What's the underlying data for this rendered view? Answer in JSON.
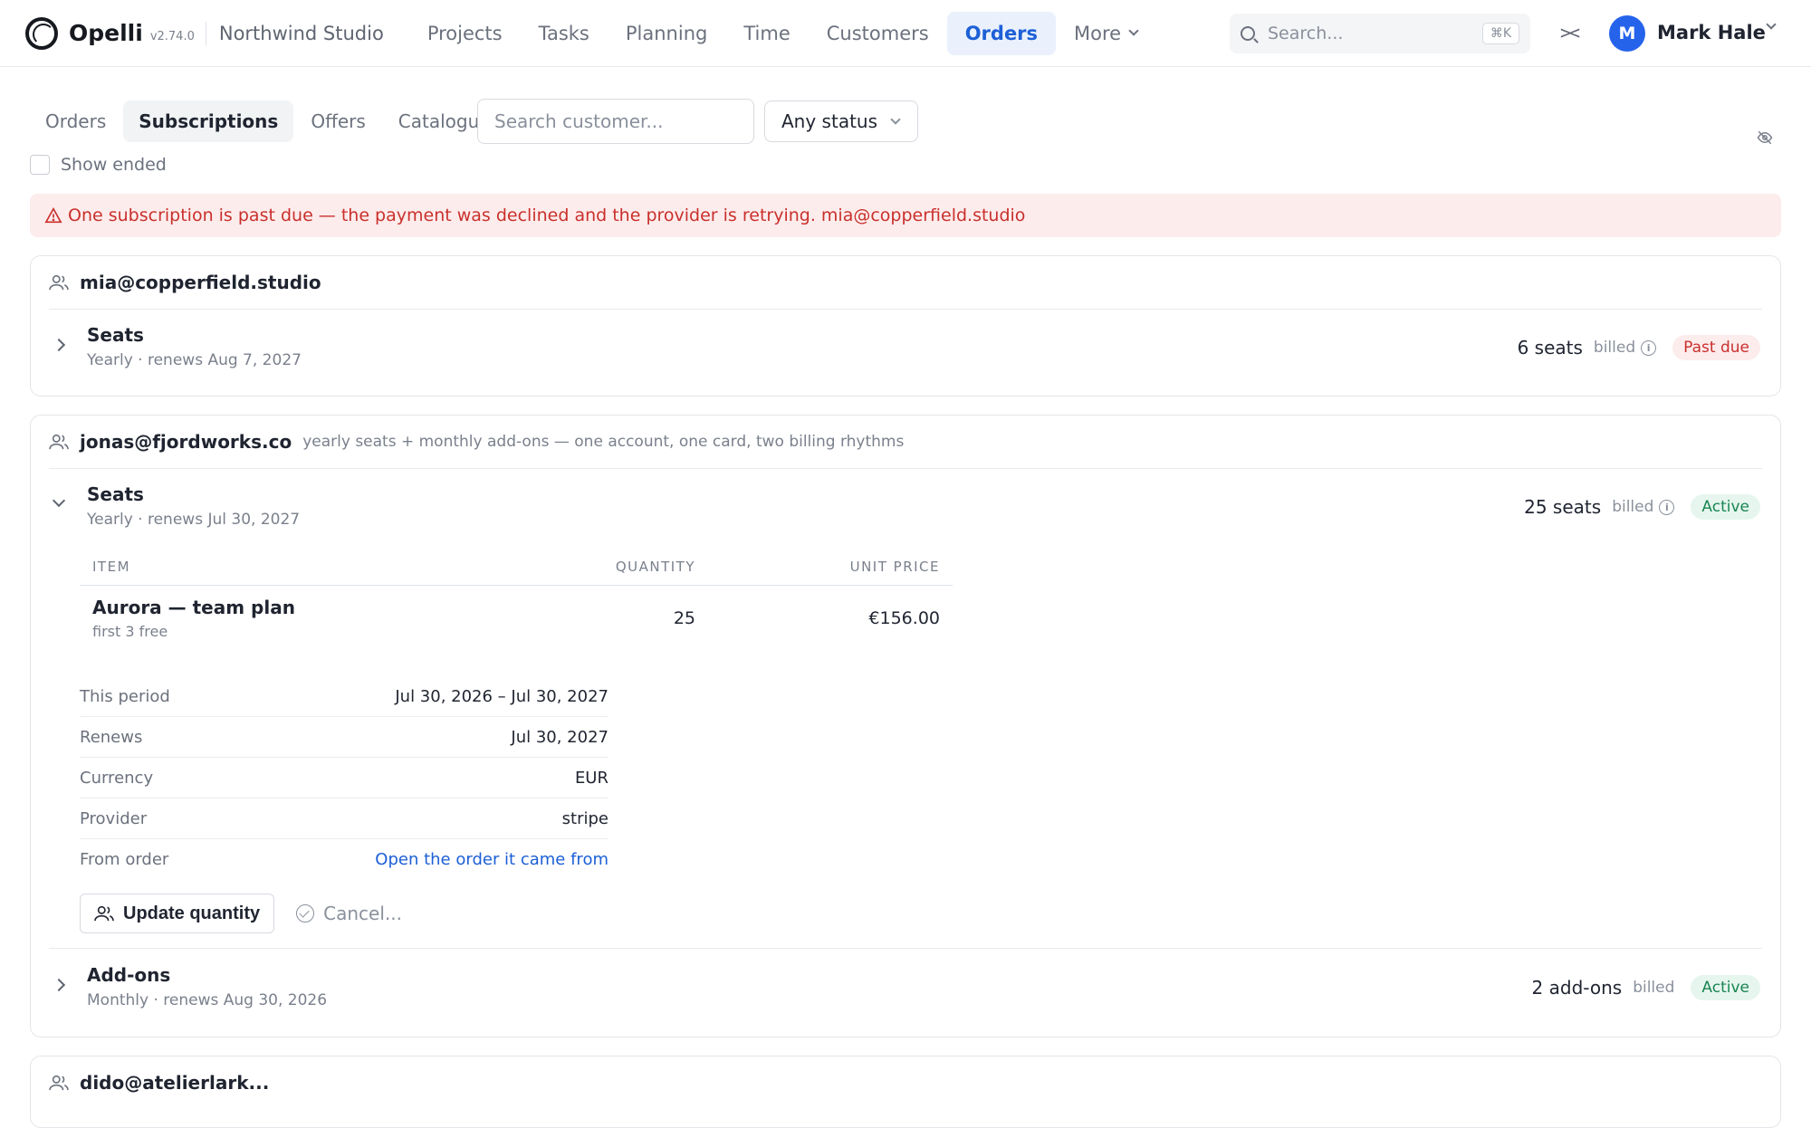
{
  "app": {
    "name": "Opelli",
    "version": "v2.74.0",
    "workspace": "Northwind Studio"
  },
  "nav": {
    "items": [
      {
        "label": "Projects"
      },
      {
        "label": "Tasks"
      },
      {
        "label": "Planning"
      },
      {
        "label": "Time"
      },
      {
        "label": "Customers"
      },
      {
        "label": "Orders"
      },
      {
        "label": "More"
      }
    ],
    "active": "Orders"
  },
  "search": {
    "placeholder": "Search...",
    "shortcut": "⌘K"
  },
  "user": {
    "initial": "M",
    "name": "Mark Hale"
  },
  "subtabs": {
    "items": [
      {
        "label": "Orders"
      },
      {
        "label": "Subscriptions"
      },
      {
        "label": "Offers"
      },
      {
        "label": "Catalogue"
      }
    ],
    "active": "Subscriptions"
  },
  "filters": {
    "customer_placeholder": "Search customer...",
    "status_value": "Any status",
    "show_ended_label": "Show ended"
  },
  "alert": {
    "text": "One subscription is past due — the payment was declined and the provider is retrying. mia@copperfield.studio"
  },
  "customers": [
    {
      "email": "mia@copperfield.studio",
      "subscriptions": [
        {
          "title": "Seats",
          "meta": "Yearly · renews Aug 7, 2027",
          "qty": "6 seats",
          "billed": "billed",
          "status": "Past due"
        }
      ]
    },
    {
      "email": "jonas@fjordworks.co",
      "note": "yearly seats + monthly add-ons — one account, one card, two billing rhythms",
      "subscriptions": [
        {
          "title": "Seats",
          "meta": "Yearly · renews Jul 30, 2027",
          "qty": "25 seats",
          "billed": "billed",
          "status": "Active",
          "table": {
            "headers": [
              "ITEM",
              "QUANTITY",
              "UNIT PRICE"
            ],
            "rows": [
              {
                "item": "Aurora — team plan",
                "note": "first 3 free",
                "quantity": "25",
                "unit_price": "€156.00"
              }
            ]
          },
          "details": [
            {
              "label": "This period",
              "value": "Jul 30, 2026 – Jul 30, 2027"
            },
            {
              "label": "Renews",
              "value": "Jul 30, 2027"
            },
            {
              "label": "Currency",
              "value": "EUR"
            },
            {
              "label": "Provider",
              "value": "stripe"
            },
            {
              "label": "From order",
              "value": "Open the order it came from"
            }
          ],
          "actions": {
            "update": "Update quantity",
            "cancel": "Cancel..."
          }
        },
        {
          "title": "Add-ons",
          "meta": "Monthly · renews Aug 30, 2026",
          "qty": "2 add-ons",
          "billed": "billed",
          "status": "Active"
        }
      ]
    },
    {
      "email": "dido@atelierlark..."
    }
  ],
  "colors": {
    "accent": "#1d5fd6",
    "avatar": "#2563eb",
    "danger": "#c9302c",
    "success": "#1a8553"
  },
  "icons": [
    "search-icon",
    "collapse-icon",
    "chevron-down-icon",
    "eye-off-icon",
    "warning-icon",
    "people-icon",
    "info-icon",
    "cancel-icon"
  ]
}
